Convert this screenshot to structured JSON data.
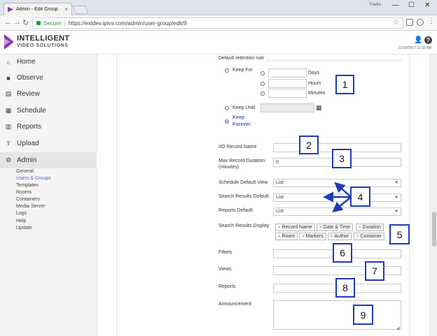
{
  "browser": {
    "tab_title": "Admin - Edit Group",
    "tab_close": "×",
    "badge": "Tradio",
    "win_minimize": "—",
    "win_maximize": "☐",
    "win_close": "✕",
    "secure_label": "Secure",
    "separator": "|",
    "url": "https://extdev.ipivs.com/admin/user-group/edit/9"
  },
  "app": {
    "brand_line1": "INTELLIGENT",
    "brand_line2": "VIDEO SOLUTIONS",
    "help_label": "?",
    "datetime": "12/19/2017 11:33 AM",
    "brand_color": "#8e3cb5",
    "accent_color": "#4a5bd0",
    "callout_color": "#1f3bb8"
  },
  "sidebar": {
    "items": [
      {
        "label": "Home",
        "icon": "home-icon"
      },
      {
        "label": "Observe",
        "icon": "video-camera-icon"
      },
      {
        "label": "Review",
        "icon": "film-icon"
      },
      {
        "label": "Schedule",
        "icon": "calendar-icon"
      },
      {
        "label": "Reports",
        "icon": "bar-chart-icon"
      },
      {
        "label": "Upload",
        "icon": "upload-icon"
      },
      {
        "label": "Admin",
        "icon": "gear-icon",
        "active": true
      }
    ],
    "subitems": [
      "General",
      "Users & Groups",
      "Templates",
      "Rooms",
      "Containers",
      "Media Server",
      "Logs",
      "Help",
      "Update"
    ],
    "active_subitem": "Users & Groups"
  },
  "form": {
    "retention_title": "Default retention rule",
    "keep_for": "Keep For",
    "days": "Days",
    "hours": "Hours",
    "minutes": "Minutes",
    "keep_until": "Keep Until",
    "keep_forever_1": "Keep",
    "keep_forever_2": "Forever",
    "io_record_name": "I/O Record Name",
    "max_record_1": "Max Record Duration",
    "max_record_2": "(minutes)",
    "max_record_value": "0",
    "schedule_default_view": "Schedule Default View",
    "schedule_default_value": "List",
    "search_results_default": "Search Results Default",
    "search_results_default_value": "List",
    "reports_default": "Reports Default",
    "reports_default_value": "List",
    "search_results_display": "Search Results Display",
    "display_tags": [
      "Record Name",
      "Date & Time",
      "Duration",
      "Room",
      "Markers",
      "Author",
      "Container"
    ],
    "tag_remove": "×",
    "filters": "Filters",
    "views": "Views",
    "reports": "Reports",
    "announcement": "Announcement"
  },
  "callouts": [
    "1",
    "2",
    "3",
    "4",
    "5",
    "6",
    "7",
    "8",
    "9"
  ]
}
